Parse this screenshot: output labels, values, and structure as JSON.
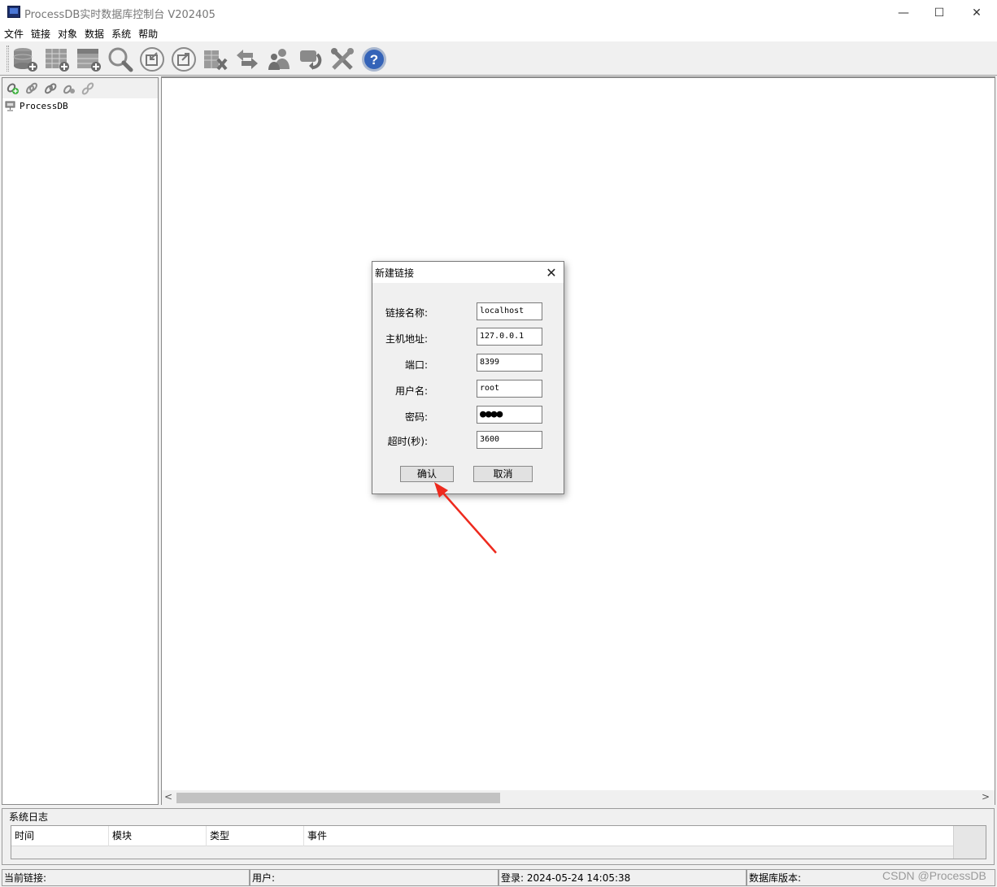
{
  "window": {
    "title": "ProcessDB实时数据库控制台 V202405",
    "min_glyph": "—",
    "max_glyph": "☐",
    "close_glyph": "✕"
  },
  "menu": [
    "文件",
    "链接",
    "对象",
    "数据",
    "系统",
    "帮助"
  ],
  "toolbar": {
    "icons": [
      "new-database-icon",
      "new-table-icon",
      "new-row-icon",
      "search-icon",
      "import-icon",
      "export-icon",
      "database-tools-icon",
      "transfer-icon",
      "user-manage-icon",
      "sync-icon",
      "settings-icon",
      "help-icon"
    ],
    "help_glyph": "?"
  },
  "left_panel": {
    "toolbar_icons": [
      "link-add-icon",
      "link-edit-icon",
      "link-connect-icon",
      "link-share-icon",
      "link-disconnect-icon"
    ],
    "tree": [
      {
        "label": "ProcessDB"
      }
    ]
  },
  "main_panel": {
    "scroll_left": "<",
    "scroll_right": ">"
  },
  "dialog": {
    "title": "新建链接",
    "close_glyph": "✕",
    "fields": [
      {
        "label": "链接名称:",
        "value": "localhost"
      },
      {
        "label": "主机地址:",
        "value": "127.0.0.1"
      },
      {
        "label": "端口:",
        "value": "8399"
      },
      {
        "label": "用户名:",
        "value": "root"
      },
      {
        "label": "密码:",
        "value": "●●●●"
      },
      {
        "label": "超时(秒):",
        "value": "3600"
      }
    ],
    "ok_label": "确认",
    "cancel_label": "取消"
  },
  "annotation": {
    "arrow_color": "#ee2a1e"
  },
  "log": {
    "title": "系统日志",
    "columns": [
      "时间",
      "模块",
      "类型",
      "事件"
    ]
  },
  "status_bar": {
    "current_link": "当前链接:",
    "user": "用户:",
    "login": "登录: 2024-05-24 14:05:38",
    "db_version": "数据库版本:"
  },
  "watermark": "CSDN @ProcessDB"
}
